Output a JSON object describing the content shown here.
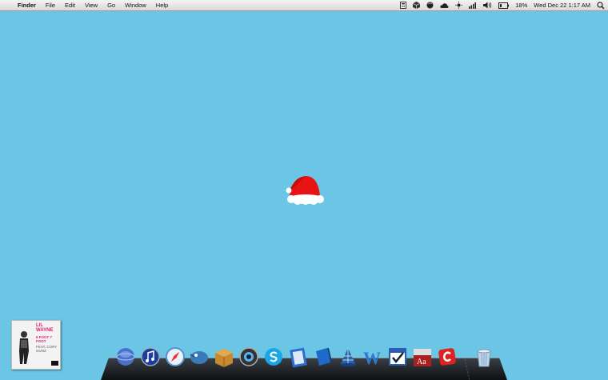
{
  "menubar": {
    "apple_symbol": "",
    "items": [
      {
        "label": "Finder",
        "bold": true
      },
      {
        "label": "File"
      },
      {
        "label": "Edit"
      },
      {
        "label": "View"
      },
      {
        "label": "Go"
      },
      {
        "label": "Window"
      },
      {
        "label": "Help"
      }
    ],
    "status": {
      "battery_percent": "18%",
      "datetime": "Wed Dec 22  1:17 AM"
    }
  },
  "desktop": {
    "background_color": "#6ac6e4",
    "album_art": {
      "artist": "LIL WAYNE",
      "title": "6 FOOT 7 FOOT",
      "feat": "FEAT. CORY GUNZ"
    }
  },
  "dock": {
    "icons": [
      "itunes-globe-icon",
      "itunes-icon",
      "safari-icon",
      "twitter-bird-icon",
      "package-icon",
      "quicktime-icon",
      "skype-icon",
      "textwrangler-icon",
      "blue-book-icon",
      "network-icon",
      "word-icon",
      "checkbox-icon",
      "dictionary-icon",
      "cloudapp-icon",
      "trash-icon"
    ],
    "dictionary_label": "Aa"
  }
}
